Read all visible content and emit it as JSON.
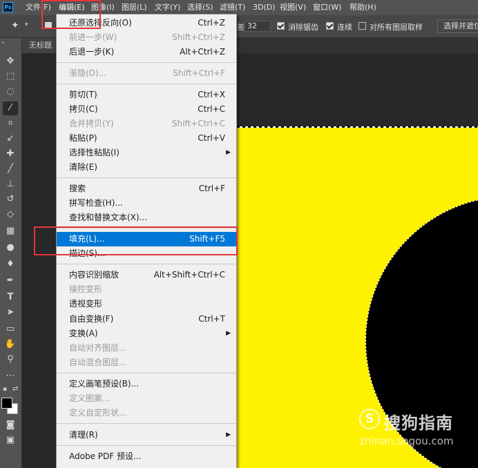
{
  "menubar": {
    "logo": "Ps",
    "items": [
      "文件(F)",
      "编辑(E)",
      "图像(I)",
      "图层(L)",
      "文字(Y)",
      "选择(S)",
      "滤镜(T)",
      "3D(D)",
      "视图(V)",
      "窗口(W)",
      "帮助(H)"
    ]
  },
  "options_bar": {
    "tolerance_label": "差:",
    "tolerance_value": "32",
    "anti_alias_label": "消除锯齿",
    "anti_alias_checked": true,
    "contiguous_label": "连续",
    "contiguous_checked": true,
    "sample_all_label": "对所有图层取样",
    "sample_all_checked": false,
    "select_mask_button": "选择并遮住"
  },
  "document": {
    "tab_label": "无标题",
    "canvas_color": "#fff200",
    "shape_color": "#000000"
  },
  "toolbar": {
    "foreground_color": "#000000",
    "background_color": "#ffffff",
    "tools": [
      "move-icon",
      "marquee-icon",
      "lasso-icon",
      "magic-wand-icon",
      "crop-icon",
      "eyedropper-icon",
      "healing-brush-icon",
      "brush-icon",
      "clone-stamp-icon",
      "history-brush-icon",
      "eraser-icon",
      "gradient-icon",
      "blur-icon",
      "dodge-icon",
      "pen-icon",
      "type-icon",
      "path-select-icon",
      "rectangle-icon",
      "hand-icon",
      "zoom-icon",
      "more-icon"
    ]
  },
  "edit_menu": {
    "items": [
      {
        "label": "还原选择反向(O)",
        "shortcut": "Ctrl+Z",
        "enabled": true
      },
      {
        "label": "前进一步(W)",
        "shortcut": "Shift+Ctrl+Z",
        "enabled": false
      },
      {
        "label": "后退一步(K)",
        "shortcut": "Alt+Ctrl+Z",
        "enabled": true
      },
      {
        "label": "渐隐(D)...",
        "shortcut": "Shift+Ctrl+F",
        "enabled": false
      },
      {
        "label": "剪切(T)",
        "shortcut": "Ctrl+X",
        "enabled": true
      },
      {
        "label": "拷贝(C)",
        "shortcut": "Ctrl+C",
        "enabled": true
      },
      {
        "label": "合并拷贝(Y)",
        "shortcut": "Shift+Ctrl+C",
        "enabled": false
      },
      {
        "label": "粘贴(P)",
        "shortcut": "Ctrl+V",
        "enabled": true
      },
      {
        "label": "选择性粘贴(I)",
        "shortcut": "",
        "enabled": true,
        "submenu": true
      },
      {
        "label": "清除(E)",
        "shortcut": "",
        "enabled": true
      },
      {
        "label": "搜索",
        "shortcut": "Ctrl+F",
        "enabled": true
      },
      {
        "label": "拼写检查(H)...",
        "shortcut": "",
        "enabled": true
      },
      {
        "label": "查找和替换文本(X)...",
        "shortcut": "",
        "enabled": true
      },
      {
        "label": "填充(L)...",
        "shortcut": "Shift+F5",
        "enabled": true,
        "highlighted": true
      },
      {
        "label": "描边(S)...",
        "shortcut": "",
        "enabled": true
      },
      {
        "label": "内容识别缩放",
        "shortcut": "Alt+Shift+Ctrl+C",
        "enabled": true
      },
      {
        "label": "操控变形",
        "shortcut": "",
        "enabled": false
      },
      {
        "label": "透视变形",
        "shortcut": "",
        "enabled": true
      },
      {
        "label": "自由变换(F)",
        "shortcut": "Ctrl+T",
        "enabled": true
      },
      {
        "label": "变换(A)",
        "shortcut": "",
        "enabled": true,
        "submenu": true
      },
      {
        "label": "自动对齐图层...",
        "shortcut": "",
        "enabled": false
      },
      {
        "label": "自动混合图层...",
        "shortcut": "",
        "enabled": false
      },
      {
        "label": "定义画笔预设(B)...",
        "shortcut": "",
        "enabled": true
      },
      {
        "label": "定义图案...",
        "shortcut": "",
        "enabled": false
      },
      {
        "label": "定义自定形状...",
        "shortcut": "",
        "enabled": false
      },
      {
        "label": "清理(R)",
        "shortcut": "",
        "enabled": true,
        "submenu": true
      },
      {
        "label": "Adobe PDF 预设...",
        "shortcut": "",
        "enabled": true
      }
    ]
  },
  "watermark": {
    "icon": "S",
    "text": "搜狗指南",
    "url": "zhinan.sogou.com"
  }
}
